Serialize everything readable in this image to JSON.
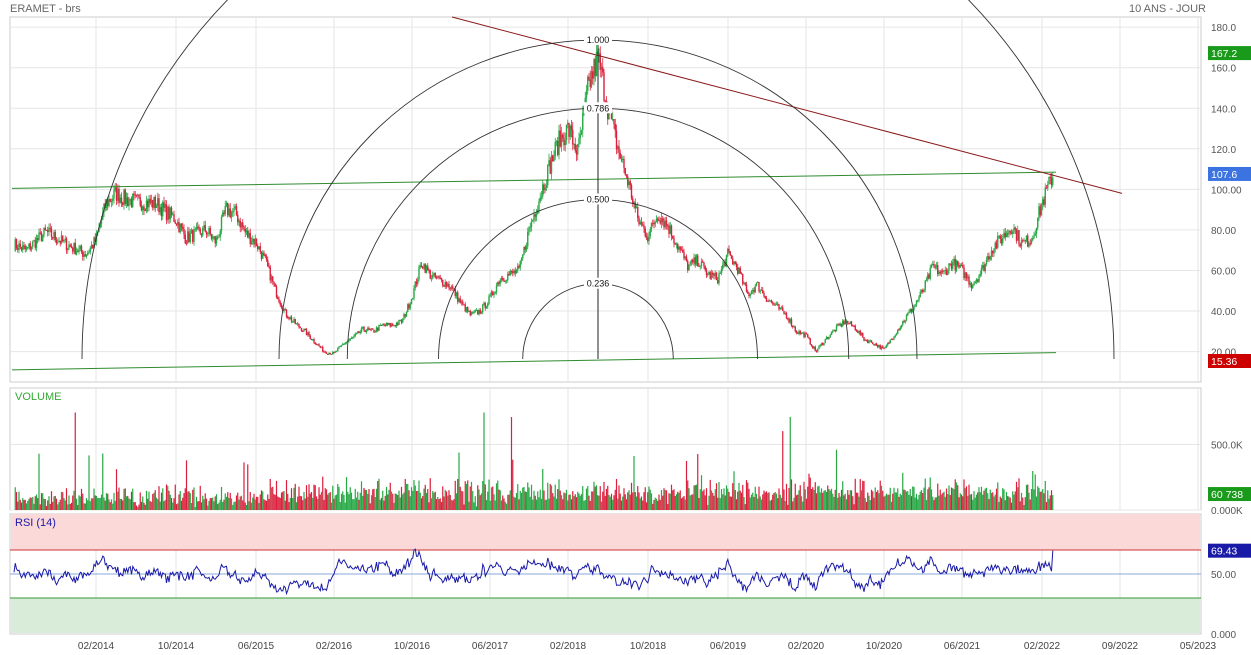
{
  "header": {
    "title": "ERAMET - brs",
    "period": "10 ANS - JOUR"
  },
  "chart_data": [
    {
      "type": "candlestick",
      "panel": "price",
      "yaxis": {
        "ticks": [
          "180.0",
          "160.0",
          "140.0",
          "120.0",
          "100.00",
          "80.00",
          "60.00",
          "40.00",
          "20.00"
        ],
        "tick_values": [
          180,
          160,
          140,
          120,
          100,
          80,
          60,
          40,
          20
        ],
        "range": [
          5,
          185
        ]
      },
      "x_ticks": [
        "02/2014",
        "10/2014",
        "06/2015",
        "02/2016",
        "10/2016",
        "06/2017",
        "02/2018",
        "10/2018",
        "06/2019",
        "02/2020",
        "10/2020",
        "06/2021",
        "02/2022",
        "09/2022",
        "05/2023"
      ],
      "markers": [
        {
          "label": "167.2",
          "value": 167.2,
          "color": "#1a9a1a"
        },
        {
          "label": "107.6",
          "value": 107.6,
          "color": "#3b73e0"
        },
        {
          "label": "15.36",
          "value": 15.36,
          "color": "#cc0000"
        }
      ],
      "fibonacci_arcs": [
        {
          "label": "1.000",
          "level": 1.0
        },
        {
          "label": "0.786",
          "level": 0.786
        },
        {
          "label": "0.500",
          "level": 0.5
        },
        {
          "label": "0.236",
          "level": 0.236
        }
      ],
      "price_path": [
        [
          "2013-05",
          75
        ],
        [
          "2013-07",
          70
        ],
        [
          "2013-09",
          79
        ],
        [
          "2013-11",
          73
        ],
        [
          "2014-01",
          68
        ],
        [
          "2014-02",
          75
        ],
        [
          "2014-03",
          93
        ],
        [
          "2014-04",
          98
        ],
        [
          "2014-05",
          95
        ],
        [
          "2014-06",
          94
        ],
        [
          "2014-08",
          93
        ],
        [
          "2014-10",
          85
        ],
        [
          "2014-11",
          76
        ],
        [
          "2014-12",
          78
        ],
        [
          "2015-01",
          80
        ],
        [
          "2015-02",
          74
        ],
        [
          "2015-03",
          90
        ],
        [
          "2015-04",
          88
        ],
        [
          "2015-05",
          78
        ],
        [
          "2015-06",
          74
        ],
        [
          "2015-07",
          64
        ],
        [
          "2015-08",
          50
        ],
        [
          "2015-09",
          39
        ],
        [
          "2015-10",
          34
        ],
        [
          "2015-11",
          30
        ],
        [
          "2015-12",
          25
        ],
        [
          "2016-01",
          20
        ],
        [
          "2016-02",
          19
        ],
        [
          "2016-03",
          24
        ],
        [
          "2016-04",
          27
        ],
        [
          "2016-05",
          31
        ],
        [
          "2016-06",
          30
        ],
        [
          "2016-07",
          33
        ],
        [
          "2016-08",
          33
        ],
        [
          "2016-09",
          35
        ],
        [
          "2016-10",
          47
        ],
        [
          "2016-11",
          64
        ],
        [
          "2016-12",
          57
        ],
        [
          "2017-01",
          55
        ],
        [
          "2017-02",
          52
        ],
        [
          "2017-03",
          44
        ],
        [
          "2017-04",
          38
        ],
        [
          "2017-05",
          40
        ],
        [
          "2017-06",
          46
        ],
        [
          "2017-07",
          56
        ],
        [
          "2017-08",
          58
        ],
        [
          "2017-09",
          60
        ],
        [
          "2017-10",
          80
        ],
        [
          "2017-11",
          95
        ],
        [
          "2017-12",
          110
        ],
        [
          "2018-01",
          123
        ],
        [
          "2018-02",
          130
        ],
        [
          "2018-03",
          118
        ],
        [
          "2018-04",
          150
        ],
        [
          "2018-05",
          165
        ],
        [
          "2018-06",
          140
        ],
        [
          "2018-07",
          120
        ],
        [
          "2018-08",
          104
        ],
        [
          "2018-09",
          85
        ],
        [
          "2018-10",
          77
        ],
        [
          "2018-11",
          88
        ],
        [
          "2018-12",
          82
        ],
        [
          "2019-01",
          72
        ],
        [
          "2019-02",
          62
        ],
        [
          "2019-03",
          65
        ],
        [
          "2019-04",
          58
        ],
        [
          "2019-05",
          56
        ],
        [
          "2019-06",
          68
        ],
        [
          "2019-07",
          61
        ],
        [
          "2019-08",
          48
        ],
        [
          "2019-09",
          53
        ],
        [
          "2019-10",
          46
        ],
        [
          "2019-11",
          42
        ],
        [
          "2019-12",
          38
        ],
        [
          "2020-01",
          30
        ],
        [
          "2020-02",
          28
        ],
        [
          "2020-03",
          20
        ],
        [
          "2020-04",
          26
        ],
        [
          "2020-05",
          31
        ],
        [
          "2020-06",
          35
        ],
        [
          "2020-07",
          32
        ],
        [
          "2020-08",
          26
        ],
        [
          "2020-09",
          24
        ],
        [
          "2020-10",
          21
        ],
        [
          "2020-11",
          28
        ],
        [
          "2020-12",
          35
        ],
        [
          "2021-01",
          42
        ],
        [
          "2021-02",
          50
        ],
        [
          "2021-03",
          62
        ],
        [
          "2021-04",
          58
        ],
        [
          "2021-05",
          64
        ],
        [
          "2021-06",
          60
        ],
        [
          "2021-07",
          53
        ],
        [
          "2021-08",
          60
        ],
        [
          "2021-09",
          71
        ],
        [
          "2021-10",
          76
        ],
        [
          "2021-11",
          82
        ],
        [
          "2021-12",
          73
        ],
        [
          "2022-01",
          76
        ],
        [
          "2022-02",
          93
        ],
        [
          "2022-03",
          107.6
        ]
      ]
    },
    {
      "type": "bar",
      "panel": "volume",
      "label": "VOLUME",
      "yaxis": {
        "ticks": [
          "500.0K",
          "0.000K"
        ],
        "tick_values": [
          500000,
          0
        ]
      },
      "last_value_label": "60 738",
      "last_value": 60738
    },
    {
      "type": "line",
      "panel": "rsi",
      "label": "RSI (14)",
      "yaxis": {
        "ticks": [
          "50.00",
          "0.000"
        ],
        "tick_values": [
          50,
          0
        ],
        "range": [
          0,
          100
        ]
      },
      "overbought": 70,
      "neutral": 50,
      "oversold": 30,
      "last_value_label": "69.43",
      "last_value": 69.43
    }
  ],
  "colors": {
    "up": "#27a845",
    "down": "#dc1f3c",
    "trend_green": "#2e8b2e",
    "trend_red": "#8b1a1a",
    "rsi_line": "#1a1aa8",
    "overbought_fill": "#fbd9d9",
    "oversold_fill": "#d9ecd9"
  }
}
